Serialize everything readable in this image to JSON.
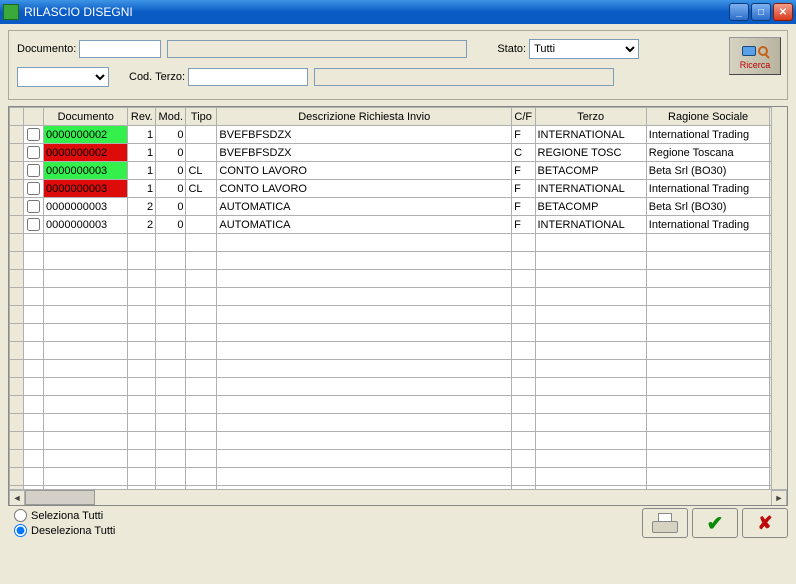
{
  "window": {
    "title": "RILASCIO DISEGNI"
  },
  "labels": {
    "documento": "Documento:",
    "stato": "Stato:",
    "cod_terzo": "Cod. Terzo:",
    "ricerca": "Ricerca",
    "seleziona_tutti": "Seleziona Tutti",
    "deseleziona_tutti": "Deseleziona Tutti"
  },
  "fields": {
    "documento": "",
    "documento_desc": "",
    "stato": "Tutti",
    "combo1": "",
    "cod_terzo": "",
    "cod_terzo_desc": ""
  },
  "headers": {
    "documento": "Documento",
    "rev": "Rev.",
    "mod": "Mod.",
    "tipo": "Tipo",
    "descrizione": "Descrizione Richiesta Invio",
    "cf": "C/F",
    "terzo": "Terzo",
    "ragione": "Ragione Sociale"
  },
  "rows": [
    {
      "checked": false,
      "doc": "0000000002",
      "doc_color": "green",
      "rev": "1",
      "mod": "0",
      "tipo": "",
      "desc": "BVEFBFSDZX",
      "cf": "F",
      "terzo": "INTERNATIONAL",
      "ragione": "International Trading"
    },
    {
      "checked": false,
      "doc": "0000000002",
      "doc_color": "red",
      "rev": "1",
      "mod": "0",
      "tipo": "",
      "desc": "BVEFBFSDZX",
      "cf": "C",
      "terzo": "REGIONE TOSC",
      "ragione": "Regione Toscana"
    },
    {
      "checked": false,
      "doc": "0000000003",
      "doc_color": "green",
      "rev": "1",
      "mod": "0",
      "tipo": "CL",
      "desc": "CONTO LAVORO",
      "cf": "F",
      "terzo": "BETACOMP",
      "ragione": "Beta Srl   (BO30)"
    },
    {
      "checked": false,
      "doc": "0000000003",
      "doc_color": "red",
      "rev": "1",
      "mod": "0",
      "tipo": "CL",
      "desc": "CONTO LAVORO",
      "cf": "F",
      "terzo": "INTERNATIONAL",
      "ragione": "International Trading"
    },
    {
      "checked": false,
      "doc": "0000000003",
      "doc_color": "",
      "rev": "2",
      "mod": "0",
      "tipo": "",
      "desc": "AUTOMATICA",
      "cf": "F",
      "terzo": "BETACOMP",
      "ragione": "Beta Srl   (BO30)"
    },
    {
      "checked": false,
      "doc": "0000000003",
      "doc_color": "",
      "rev": "2",
      "mod": "0",
      "tipo": "",
      "desc": "AUTOMATICA",
      "cf": "F",
      "terzo": "INTERNATIONAL",
      "ragione": "International Trading"
    }
  ],
  "empty_row_count": 15
}
